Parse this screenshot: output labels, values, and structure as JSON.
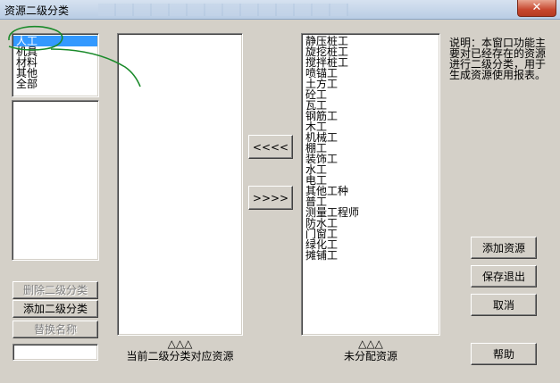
{
  "window": {
    "title": "资源二级分类",
    "close_glyph": "✕"
  },
  "categories": [
    "人工",
    "机具",
    "材料",
    "其他",
    "全部"
  ],
  "selected_category_index": 0,
  "buttons": {
    "delete_sub": "删除二级分类",
    "add_sub": "添加二级分类",
    "rename": "替换名称",
    "move_left": "<<<<",
    "move_right": ">>>>",
    "add_resource": "添加资源",
    "save_exit": "保存退出",
    "cancel": "取消",
    "help": "帮助"
  },
  "rename_input": {
    "value": ""
  },
  "assigned_panel": {
    "arrows": "△△△",
    "label": "当前二级分类对应资源"
  },
  "unassigned_panel": {
    "arrows": "△△△",
    "label": "未分配资源",
    "items": [
      "静压桩工",
      "旋挖桩工",
      "搅拌桩工",
      "喷锚工",
      "土方工",
      "砼工",
      "瓦工",
      "钢筋工",
      "木工",
      "机械工",
      "棚工",
      "装饰工",
      "水工",
      "电工",
      "其他工种",
      "普工",
      "测量工程师",
      "防水工",
      "门窗工",
      "绿化工",
      "摊铺工"
    ]
  },
  "note": "说明：本窗口功能主要对已经存在的资源进行二级分类，用于生成资源使用报表。",
  "colors": {
    "selection": "#3399ff",
    "annotation": "#1a8a2a",
    "dialog_bg": "#d4d0c8"
  }
}
